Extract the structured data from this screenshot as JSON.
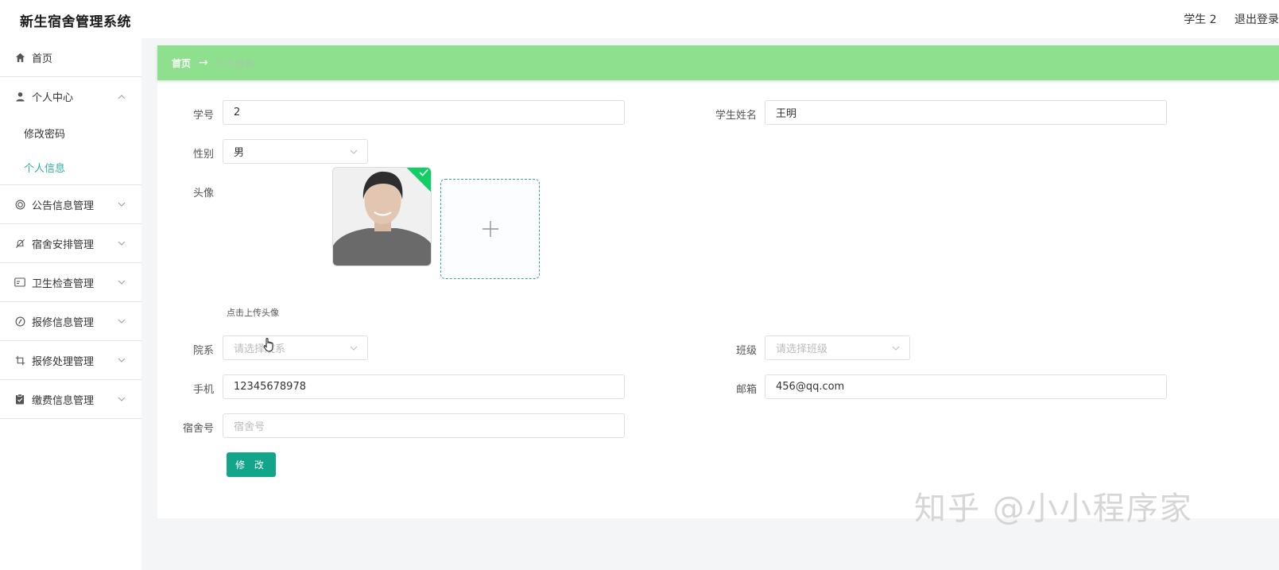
{
  "app": {
    "title": "新生宿舍管理系统"
  },
  "topbar": {
    "user": "学生 2",
    "logout": "退出登录"
  },
  "sidebar": {
    "items": [
      {
        "label": "首页",
        "icon": "home-icon"
      },
      {
        "label": "个人中心",
        "icon": "user-icon",
        "expanded": true,
        "children": [
          {
            "label": "修改密码"
          },
          {
            "label": "个人信息",
            "active": true
          }
        ]
      },
      {
        "label": "公告信息管理",
        "icon": "notice-icon"
      },
      {
        "label": "宿舍安排管理",
        "icon": "bell-off-icon"
      },
      {
        "label": "卫生检查管理",
        "icon": "id-card-icon"
      },
      {
        "label": "报修信息管理",
        "icon": "compass-icon"
      },
      {
        "label": "报修处理管理",
        "icon": "crop-icon"
      },
      {
        "label": "缴费信息管理",
        "icon": "clipboard-icon"
      }
    ]
  },
  "breadcrumb": {
    "home": "首页",
    "current": "个人信息"
  },
  "form": {
    "student_no": {
      "label": "学号",
      "value": "2"
    },
    "student_name": {
      "label": "学生姓名",
      "value": "王明"
    },
    "gender": {
      "label": "性别",
      "value": "男"
    },
    "avatar": {
      "label": "头像",
      "hint": "点击上传头像"
    },
    "department": {
      "label": "院系",
      "placeholder": "请选择院系"
    },
    "class": {
      "label": "班级",
      "placeholder": "请选择班级"
    },
    "phone": {
      "label": "手机",
      "value": "12345678978"
    },
    "email": {
      "label": "邮箱",
      "value": "456@qq.com"
    },
    "dorm_no": {
      "label": "宿舍号",
      "placeholder": "宿舍号"
    },
    "submit_label": "修 改"
  },
  "watermark": "知乎 @小小程序家",
  "colors": {
    "accent": "#2ab0a0",
    "breadcrumb_bg": "#8ee08e",
    "button": "#12a589",
    "upload_border": "#3fa08f"
  }
}
